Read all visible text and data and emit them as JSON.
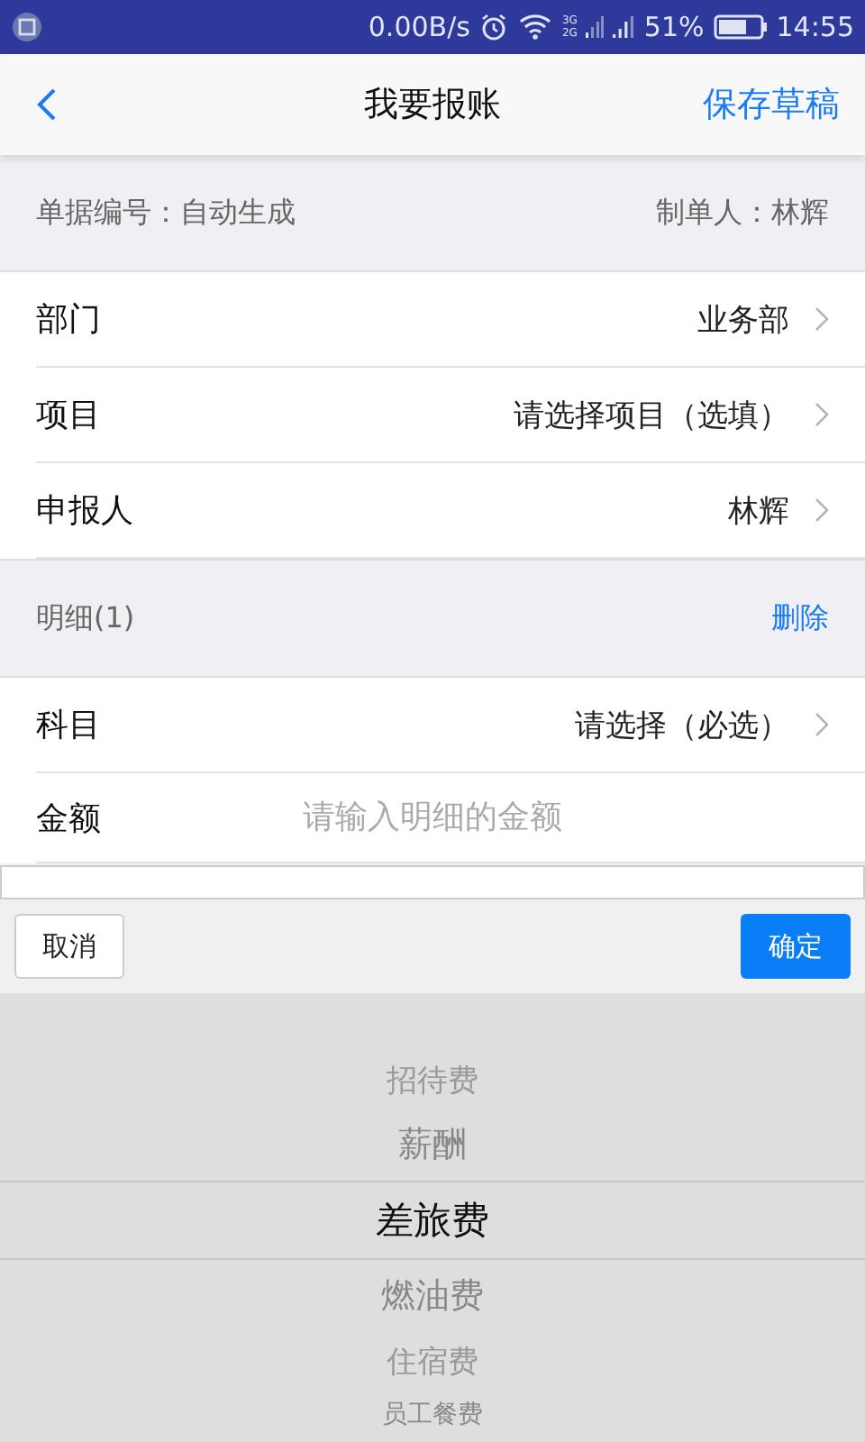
{
  "status_bar": {
    "speed": "0.00B/s",
    "network_labels": [
      "3G",
      "2G"
    ],
    "battery": "51%",
    "time": "14:55"
  },
  "nav": {
    "title": "我要报账",
    "action": "保存草稿"
  },
  "info": {
    "doc_number": "单据编号：自动生成",
    "maker": "制单人：林辉"
  },
  "fields": [
    {
      "label": "部门",
      "value": "业务部",
      "kind": "select"
    },
    {
      "label": "项目",
      "value": "请选择项目（选填）",
      "kind": "select"
    },
    {
      "label": "申报人",
      "value": "林辉",
      "kind": "select"
    }
  ],
  "details": {
    "title": "明细(1)",
    "action": "删除",
    "fields": [
      {
        "label": "科目",
        "value": "请选择（必选）",
        "kind": "select"
      },
      {
        "label": "金额",
        "placeholder": "请输入明细的金额",
        "kind": "input"
      }
    ]
  },
  "picker": {
    "cancel": "取消",
    "confirm": "确定",
    "items": [
      {
        "label": "招待费",
        "selected": false
      },
      {
        "label": "薪酬",
        "selected": false
      },
      {
        "label": "差旅费",
        "selected": true
      },
      {
        "label": "燃油费",
        "selected": false
      },
      {
        "label": "住宿费",
        "selected": false
      },
      {
        "label": "员工餐费",
        "selected": false
      }
    ]
  }
}
